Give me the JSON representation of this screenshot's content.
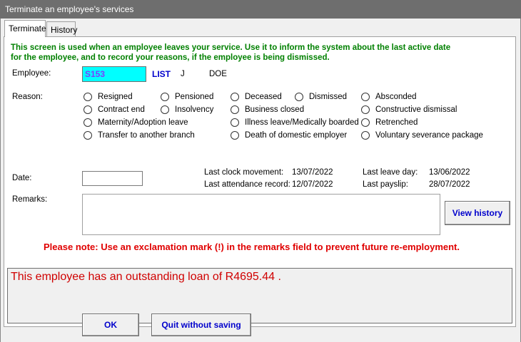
{
  "window": {
    "title": "Terminate an employee's services"
  },
  "tabs": [
    {
      "label": "Terminate"
    },
    {
      "label": "History"
    }
  ],
  "intro": {
    "line1": "This screen is used when an employee leaves your service. Use it to inform the system about the last active date",
    "line2": "for the employee, and to record your reasons, if the employee is being dismissed."
  },
  "employee": {
    "label": "Employee:",
    "code": "S153",
    "list_label": "LIST",
    "first_name": "J",
    "last_name": "DOE"
  },
  "reason": {
    "label": "Reason:",
    "options": [
      "Resigned",
      "Pensioned",
      "Deceased",
      "Dismissed",
      "Absconded",
      "Contract end",
      "Insolvency",
      "Business closed",
      "Retrenched",
      "Constructive dismissal",
      "Maternity/Adoption leave",
      "Illness leave/Medically boarded",
      "Retrenched",
      "Transfer to another branch",
      "Death of domestic employer",
      "Voluntary severance package"
    ]
  },
  "date": {
    "label": "Date:",
    "value": ""
  },
  "info": {
    "last_clock_movement_label": "Last clock movement:",
    "last_clock_movement": "13/07/2022",
    "last_attendance_record_label": "Last attendance record:",
    "last_attendance_record": "12/07/2022",
    "last_leave_day_label": "Last leave day:",
    "last_leave_day": "13/06/2022",
    "last_payslip_label": "Last payslip:",
    "last_payslip": "28/07/2022"
  },
  "remarks": {
    "label": "Remarks:",
    "value": ""
  },
  "buttons": {
    "view_history": "View history",
    "ok": "OK",
    "quit": "Quit without saving"
  },
  "note": "Please note: Use an exclamation mark (!) in the remarks field to prevent future re-employment.",
  "message": "This employee has an outstanding loan of R4695.44 ."
}
